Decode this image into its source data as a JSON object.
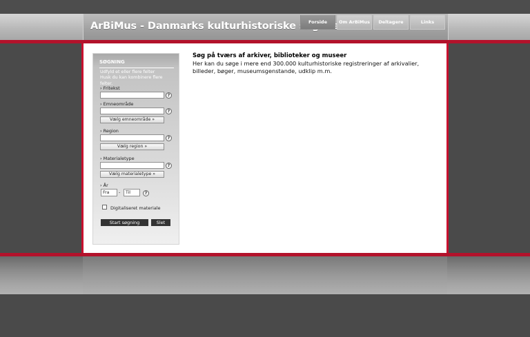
{
  "header": {
    "title": "ArBiMus - Danmarks kulturhistoriske søgebase",
    "nav": [
      {
        "label": "Forside",
        "active": true
      },
      {
        "label": "Om ArBiMus",
        "active": false
      },
      {
        "label": "Deltagere",
        "active": false
      },
      {
        "label": "Links",
        "active": false
      }
    ]
  },
  "sidebar": {
    "title": "SØGNING",
    "help_line1": "Udfyld et eller flere felter",
    "help_line2": "Husk du kan kombinere flere felter.",
    "fritekst_label": "Fritekst",
    "emneomraade_label": "Emneområde",
    "emneomraade_button": "Vælg emneområde »",
    "region_label": "Region",
    "region_button": "Vælg region »",
    "materialetype_label": "Materialetype",
    "materialetype_button": "Vælg materialetype »",
    "aar_label": "År",
    "from_value": "Fra",
    "to_value": "Til",
    "help_icon": "?",
    "digital_label": "Digitaliseret materiale",
    "search_button": "Start søgning",
    "clear_button": "Slet"
  },
  "main": {
    "heading": "Søg på tværs af arkiver, biblioteker og museer",
    "body": "Her kan du søge i mere end 300.000 kulturhistoriske registreringer af arkivalier, billeder, bøger, museumsgenstande, udklip m.m."
  }
}
